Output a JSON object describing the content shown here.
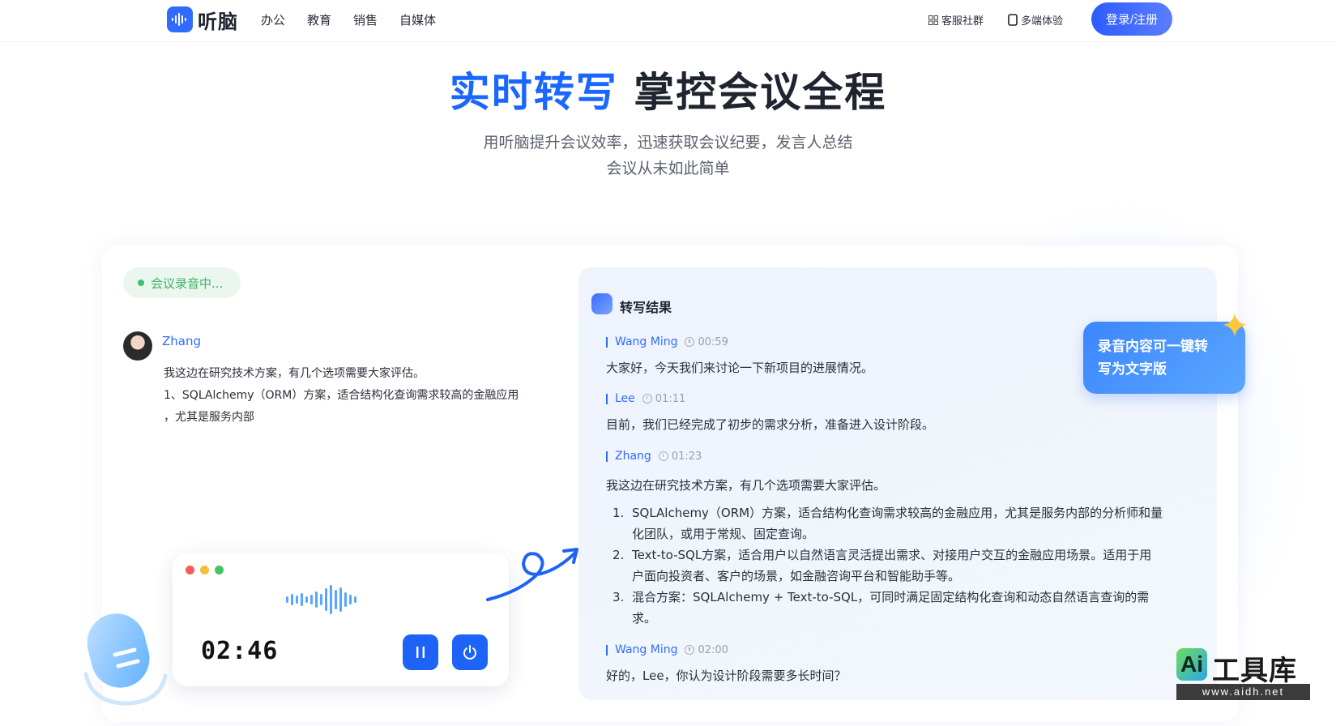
{
  "header": {
    "brand": "听脑",
    "nav": [
      "办公",
      "教育",
      "销售",
      "自媒体"
    ],
    "community": "客服社群",
    "multi_device": "多端体验",
    "login": "登录/注册"
  },
  "hero": {
    "title_highlight": "实时转写",
    "title_rest": "掌控会议全程",
    "subtitle_line1": "用听脑提升会议效率，迅速获取会议纪要，发言人总结",
    "subtitle_line2": "会议从未如此简单"
  },
  "left": {
    "badge": "会议录音中...",
    "speaker": "Zhang",
    "lines": [
      "我这边在研究技术方案，有几个选项需要大家评估。",
      "1、SQLAlchemy（ORM）方案，适合结构化查询需求较高的金融应用",
      "，尤其是服务内部"
    ],
    "timer": "02:46"
  },
  "panel": {
    "title": "转写结果",
    "entries": [
      {
        "name": "Wang Ming",
        "time": "00:59",
        "text": "大家好，今天我们来讨论一下新项目的进展情况。"
      },
      {
        "name": "Lee",
        "time": "01:11",
        "text": "目前，我们已经完成了初步的需求分析，准备进入设计阶段。"
      },
      {
        "name": "Zhang",
        "time": "01:23",
        "text": "我这边在研究技术方案，有几个选项需要大家评估。"
      },
      {
        "name": "Wang Ming",
        "time": "02:00",
        "text": "好的，Lee，你认为设计阶段需要多长时间？"
      }
    ],
    "list": [
      {
        "num": "1.",
        "line1": "SQLAlchemy（ORM）方案，适合结构化查询需求较高的金融应用，尤其是服务内部的分析师和量",
        "line2": "化团队，或用于常规、固定查询。"
      },
      {
        "num": "2.",
        "line1": "Text-to-SQL方案，适合用户以自然语言灵活提出需求、对接用户交互的金融应用场景。适用于用",
        "line2": "户面向投资者、客户的场景，如金融咨询平台和智能助手等。"
      },
      {
        "num": "3.",
        "line1": "混合方案：SQLAlchemy + Text-to-SQL，可同时满足固定结构化查询和动态自然语言查询的需",
        "line2": "求。"
      }
    ]
  },
  "callout": {
    "line1": "录音内容可一键转",
    "line2": "写为文字版"
  },
  "watermark": {
    "ai": "Ai",
    "title": "工具库",
    "url": "www.aidh.net"
  },
  "colors": {
    "accent": "#1a67ff",
    "record_green": "#3cb56a",
    "button_blue": "#1d63f5"
  }
}
